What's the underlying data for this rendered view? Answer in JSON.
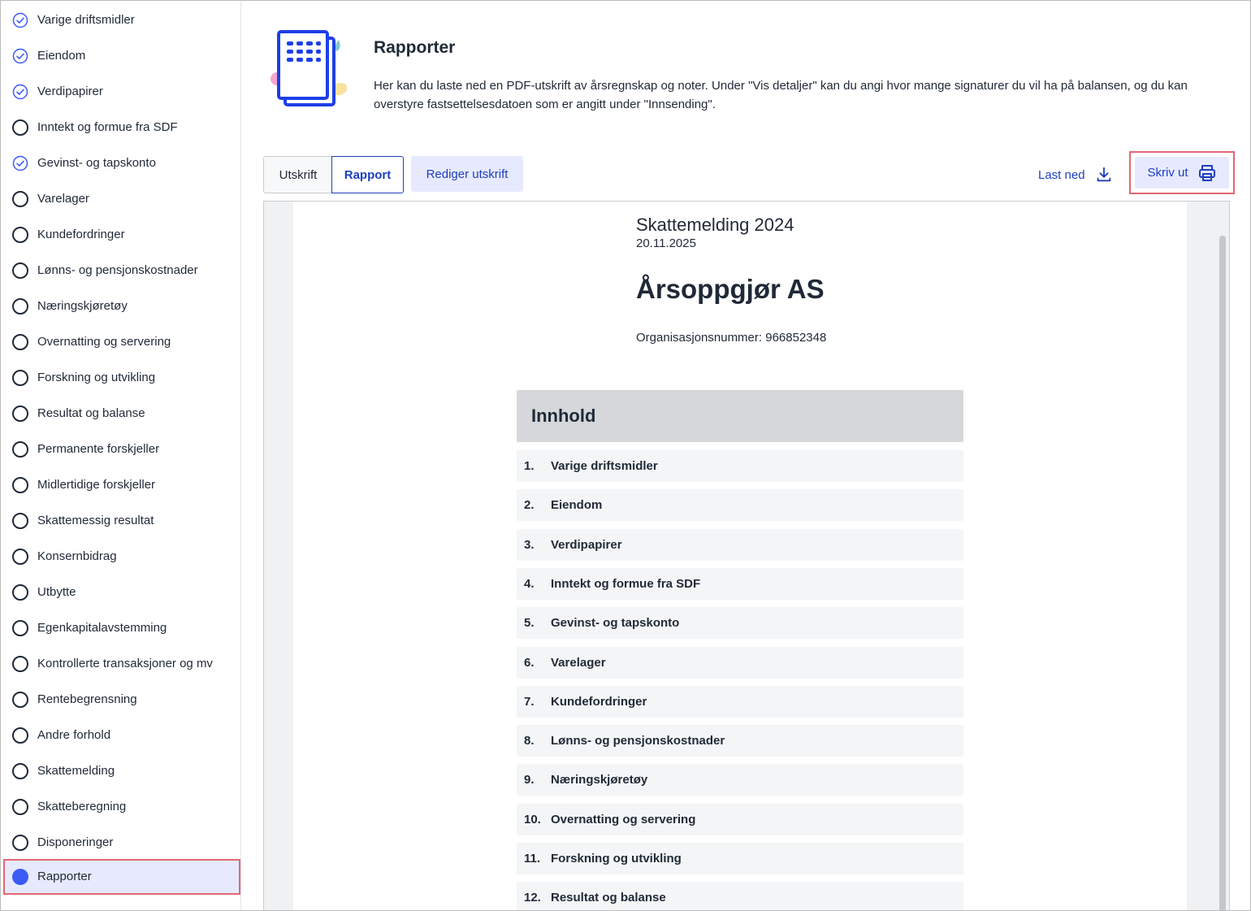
{
  "sidebar": {
    "items": [
      {
        "label": "Varige driftsmidler",
        "status": "done"
      },
      {
        "label": "Eiendom",
        "status": "done"
      },
      {
        "label": "Verdipapirer",
        "status": "done"
      },
      {
        "label": "Inntekt og formue fra SDF",
        "status": "todo"
      },
      {
        "label": "Gevinst- og tapskonto",
        "status": "done"
      },
      {
        "label": "Varelager",
        "status": "todo"
      },
      {
        "label": "Kundefordringer",
        "status": "todo"
      },
      {
        "label": "Lønns- og pensjonskostnader",
        "status": "todo"
      },
      {
        "label": "Næringskjøretøy",
        "status": "todo"
      },
      {
        "label": "Overnatting og servering",
        "status": "todo"
      },
      {
        "label": "Forskning og utvikling",
        "status": "todo"
      },
      {
        "label": "Resultat og balanse",
        "status": "todo"
      },
      {
        "label": "Permanente forskjeller",
        "status": "todo"
      },
      {
        "label": "Midlertidige forskjeller",
        "status": "todo"
      },
      {
        "label": "Skattemessig resultat",
        "status": "todo"
      },
      {
        "label": "Konsernbidrag",
        "status": "todo"
      },
      {
        "label": "Utbytte",
        "status": "todo"
      },
      {
        "label": "Egenkapitalavstemming",
        "status": "todo"
      },
      {
        "label": "Kontrollerte transaksjoner og mv",
        "status": "todo"
      },
      {
        "label": "Rentebegrensning",
        "status": "todo"
      },
      {
        "label": "Andre forhold",
        "status": "todo"
      },
      {
        "label": "Skattemelding",
        "status": "todo"
      },
      {
        "label": "Skatteberegning",
        "status": "todo"
      },
      {
        "label": "Disponeringer",
        "status": "todo"
      },
      {
        "label": "Rapporter",
        "status": "active"
      }
    ]
  },
  "header": {
    "title": "Rapporter",
    "description": "Her kan du laste ned en PDF-utskrift av årsregnskap og noter. Under \"Vis detaljer\" kan du angi hvor mange signaturer du vil ha på balansen, og du kan overstyre fastsettelsesdatoen som er angitt under \"Innsending\"."
  },
  "toolbar": {
    "tab_print": "Utskrift",
    "tab_report": "Rapport",
    "edit_label": "Rediger utskrift",
    "download_label": "Last ned",
    "print_label": "Skriv ut"
  },
  "document": {
    "title": "Skattemelding 2024",
    "date": "20.11.2025",
    "company": "Årsoppgjør AS",
    "org_number": "Organisasjonsnummer: 966852348",
    "toc_heading": "Innhold",
    "toc": [
      {
        "num": "1.",
        "label": "Varige driftsmidler"
      },
      {
        "num": "2.",
        "label": "Eiendom"
      },
      {
        "num": "3.",
        "label": "Verdipapirer"
      },
      {
        "num": "4.",
        "label": "Inntekt og formue fra SDF"
      },
      {
        "num": "5.",
        "label": "Gevinst- og tapskonto"
      },
      {
        "num": "6.",
        "label": "Varelager"
      },
      {
        "num": "7.",
        "label": "Kundefordringer"
      },
      {
        "num": "8.",
        "label": "Lønns- og pensjonskostnader"
      },
      {
        "num": "9.",
        "label": "Næringskjøretøy"
      },
      {
        "num": "10.",
        "label": "Overnatting og servering"
      },
      {
        "num": "11.",
        "label": "Forskning og utvikling"
      },
      {
        "num": "12.",
        "label": "Resultat og balanse"
      }
    ]
  },
  "colors": {
    "accent": "#1d3fbf",
    "active_bg": "#e7eafe",
    "highlight_border": "#e06873",
    "active_dot": "#3b5bf5"
  }
}
